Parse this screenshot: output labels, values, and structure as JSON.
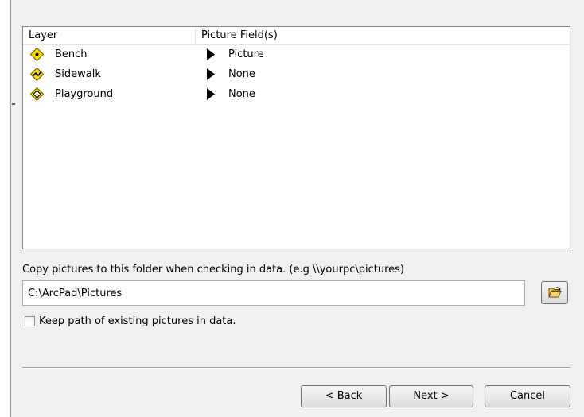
{
  "layers_table": {
    "columns": [
      "Layer",
      "Picture Field(s)"
    ],
    "rows": [
      {
        "layer": "Bench",
        "picture_field": "Picture",
        "icon": "point-layer-icon"
      },
      {
        "layer": "Sidewalk",
        "picture_field": "None",
        "icon": "line-layer-icon"
      },
      {
        "layer": "Playground",
        "picture_field": "None",
        "icon": "polygon-layer-icon"
      }
    ]
  },
  "copy_folder": {
    "label": "Copy pictures to this folder when checking in data. (e.g \\\\yourpc\\pictures)",
    "value": "C:\\ArcPad\\Pictures",
    "browse_icon": "open-folder-icon"
  },
  "keep_path": {
    "label": "Keep path of existing pictures in data.",
    "checked": false
  },
  "buttons": {
    "back": "< Back",
    "next": "Next >",
    "cancel": "Cancel"
  },
  "colors": {
    "dialog_bg": "#f0f0f0",
    "layer_icon_yellow": "#f5d800",
    "layer_icon_outline": "#6b5a00"
  }
}
